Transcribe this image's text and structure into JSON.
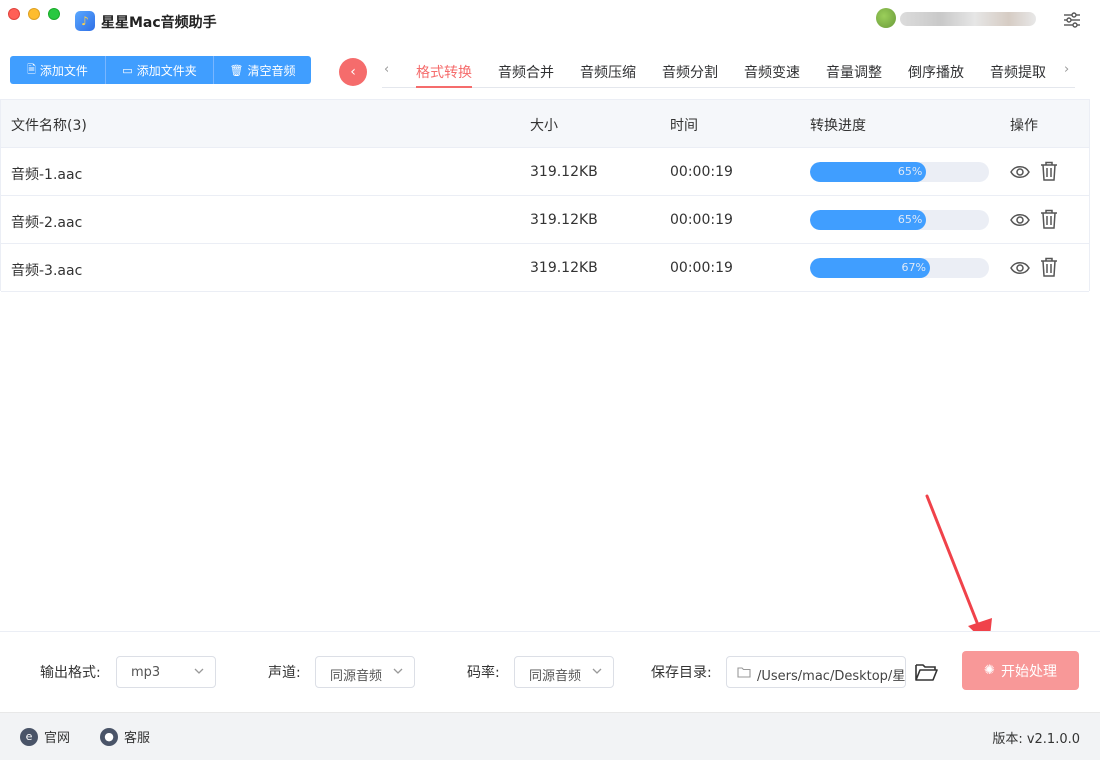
{
  "window": {
    "title": "星星Mac音频助手"
  },
  "toolbar": {
    "add_file": "添加文件",
    "add_folder": "添加文件夹",
    "clear_audio": "清空音频"
  },
  "tabs": [
    {
      "label": "格式转换",
      "active": true
    },
    {
      "label": "音频合并"
    },
    {
      "label": "音频压缩"
    },
    {
      "label": "音频分割"
    },
    {
      "label": "音频变速"
    },
    {
      "label": "音量调整"
    },
    {
      "label": "倒序播放"
    },
    {
      "label": "音频提取"
    }
  ],
  "table": {
    "headers": {
      "name": "文件名称(3)",
      "size": "大小",
      "time": "时间",
      "progress": "转换进度",
      "actions": "操作"
    },
    "rows": [
      {
        "name": "音频-1.aac",
        "size": "319.12KB",
        "time": "00:00:19",
        "progress": 65,
        "progress_label": "65%"
      },
      {
        "name": "音频-2.aac",
        "size": "319.12KB",
        "time": "00:00:19",
        "progress": 65,
        "progress_label": "65%"
      },
      {
        "name": "音频-3.aac",
        "size": "319.12KB",
        "time": "00:00:19",
        "progress": 67,
        "progress_label": "67%"
      }
    ]
  },
  "settings": {
    "format_label": "输出格式:",
    "format_value": "mp3",
    "channel_label": "声道:",
    "channel_value": "同源音频",
    "bitrate_label": "码率:",
    "bitrate_value": "同源音频",
    "save_label": "保存目录:",
    "save_path": "/Users/mac/Desktop/星",
    "start_label": "开始处理"
  },
  "footer": {
    "website": "官网",
    "support": "客服",
    "version": "版本:  v2.1.0.0"
  },
  "colors": {
    "primary": "#409eff",
    "accent": "#f56c6c",
    "start_button": "#f89898"
  }
}
